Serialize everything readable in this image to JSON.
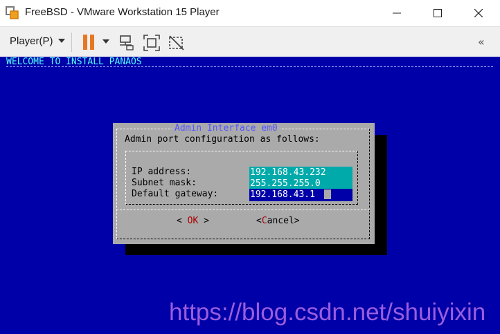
{
  "window": {
    "title": "FreeBSD - VMware Workstation 15 Player",
    "icon": "vmware-player-icon"
  },
  "toolbar": {
    "player_menu_label": "Player(P)",
    "icons": [
      "pause-icon",
      "send-ctrl-alt-del-icon",
      "fit-guest-icon",
      "unity-icon",
      "collapse-icon"
    ],
    "collapse_label": "«"
  },
  "console": {
    "header": "WELCOME TO INSTALL PANAOS",
    "colors": {
      "background": "#0000a8",
      "header": "#55ffff",
      "dialog": "#aaaaaa",
      "title": "#5555ff",
      "field": "#00aaaa",
      "hotkey": "#aa0000"
    }
  },
  "dialog": {
    "title": "Admin Interface em0",
    "message": "Admin port configuration as follows:",
    "fields": [
      {
        "label": "IP address:",
        "value": "192.168.43.232"
      },
      {
        "label": "Subnet mask:",
        "value": "255.255.255.0"
      },
      {
        "label": "Default gateway:",
        "value": "192.168.43.1"
      }
    ],
    "ok": {
      "open": "< ",
      "hotkey": "O",
      "rest": "K",
      "close": " >"
    },
    "cancel": {
      "open": "<",
      "hotkey": "C",
      "rest": "ancel",
      "close": ">"
    }
  },
  "watermark": "https://blog.csdn.net/shuiyixin"
}
